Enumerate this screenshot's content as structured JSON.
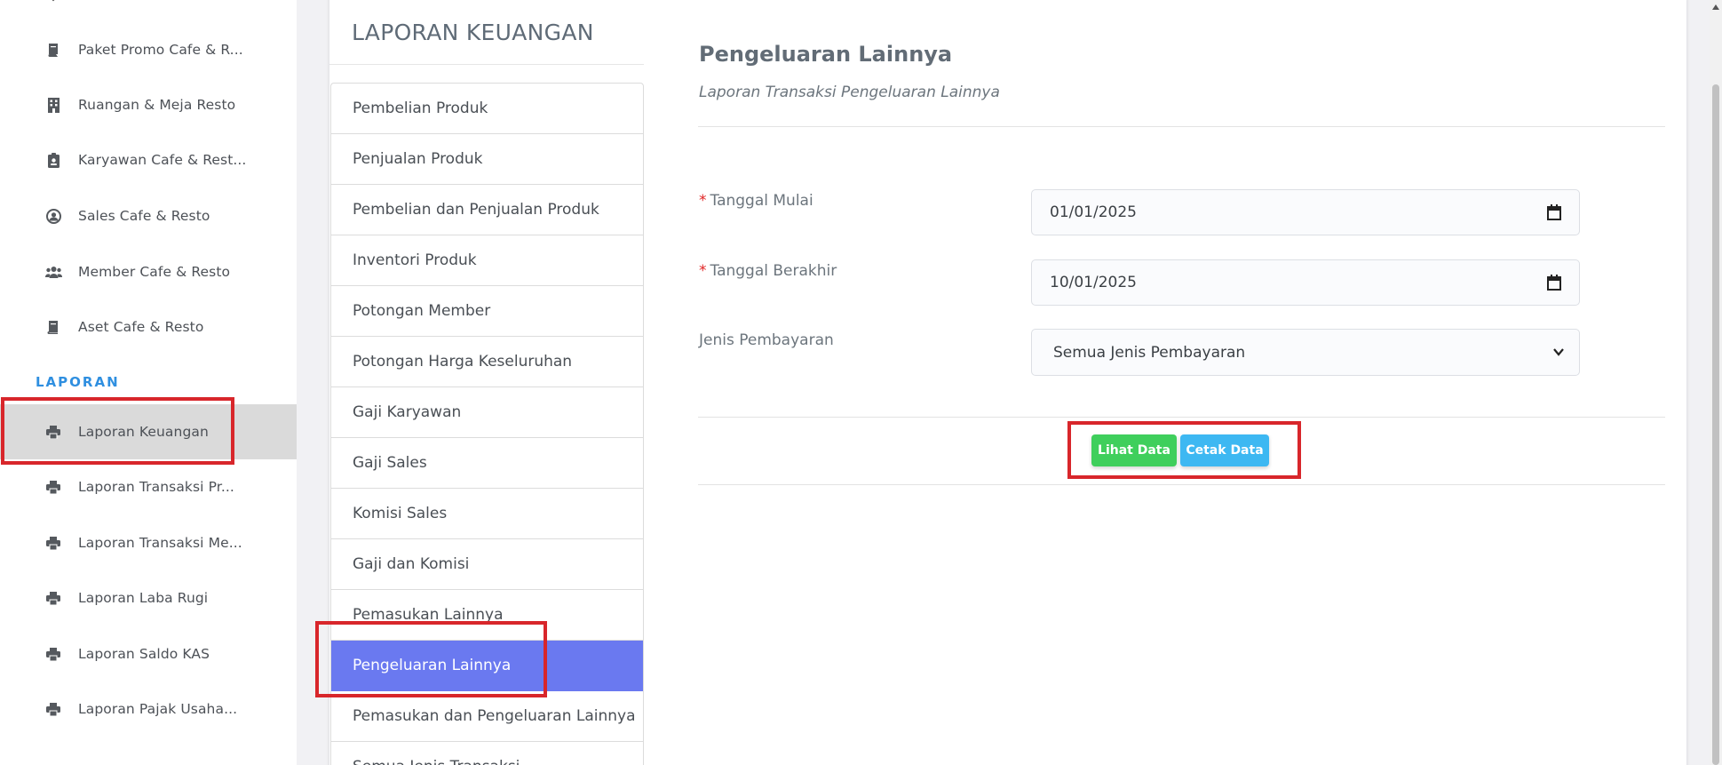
{
  "sidebar": {
    "items_top": [
      {
        "label": "Paket Promo Cafe & R...",
        "icon": "book-icon"
      },
      {
        "label": "Ruangan & Meja Resto",
        "icon": "building-icon"
      },
      {
        "label": "Karyawan Cafe & Rest...",
        "icon": "id-badge-icon"
      },
      {
        "label": "Sales Cafe & Resto",
        "icon": "user-circle-icon"
      },
      {
        "label": "Member Cafe & Resto",
        "icon": "users-icon"
      },
      {
        "label": "Aset Cafe & Resto",
        "icon": "book-icon"
      }
    ],
    "section_label": "LAPORAN",
    "items_laporan": [
      {
        "label": "Laporan Keuangan",
        "icon": "printer-icon",
        "active": true
      },
      {
        "label": "Laporan Transaksi Pr...",
        "icon": "printer-icon"
      },
      {
        "label": "Laporan Transaksi Me...",
        "icon": "printer-icon"
      },
      {
        "label": "Laporan Laba Rugi",
        "icon": "printer-icon"
      },
      {
        "label": "Laporan Saldo KAS",
        "icon": "printer-icon"
      },
      {
        "label": "Laporan Pajak Usaha...",
        "icon": "printer-icon"
      }
    ]
  },
  "report_panel": {
    "title": "LAPORAN KEUANGAN",
    "menu": [
      {
        "label": "Pembelian Produk"
      },
      {
        "label": "Penjualan Produk"
      },
      {
        "label": "Pembelian dan Penjualan Produk"
      },
      {
        "label": "Inventori Produk"
      },
      {
        "label": "Potongan Member"
      },
      {
        "label": "Potongan Harga Keseluruhan"
      },
      {
        "label": "Gaji Karyawan"
      },
      {
        "label": "Gaji Sales"
      },
      {
        "label": "Komisi Sales"
      },
      {
        "label": "Gaji dan Komisi"
      },
      {
        "label": "Pemasukan Lainnya"
      },
      {
        "label": "Pengeluaran Lainnya",
        "active": true
      },
      {
        "label": "Pemasukan dan Pengeluaran Lainnya"
      },
      {
        "label": "Semua Jenis Transaksi"
      }
    ]
  },
  "content": {
    "title": "Pengeluaran Lainnya",
    "subtitle": "Laporan Transaksi Pengeluaran Lainnya",
    "required_mark": "*",
    "fields": {
      "start_date": {
        "label": "Tanggal Mulai",
        "value": "01/01/2025"
      },
      "end_date": {
        "label": "Tanggal Berakhir",
        "value": "10/01/2025"
      },
      "payment_type": {
        "label": "Jenis Pembayaran",
        "value": "Semua Jenis Pembayaran"
      }
    },
    "buttons": {
      "view": "Lihat Data",
      "print": "Cetak Data"
    }
  },
  "colors": {
    "active_menu": "#6a79f0",
    "section_label": "#2f8fe0",
    "view_button": "#3fcf5c",
    "print_button": "#3db8f2",
    "annotation_box": "#d8262b",
    "required": "#e02424"
  }
}
